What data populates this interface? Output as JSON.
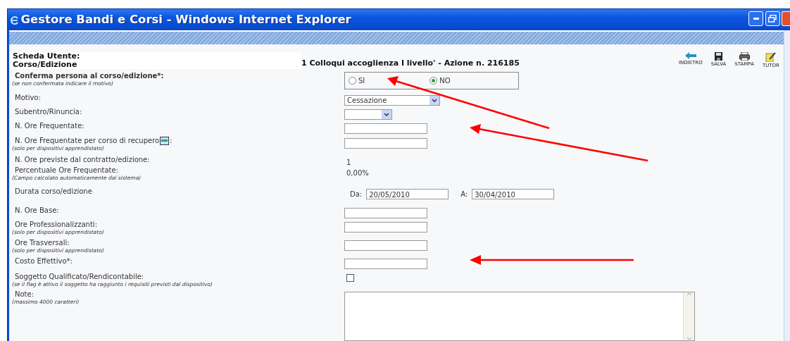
{
  "window": {
    "title": "Gestore Bandi e Corsi - Windows Internet Explorer"
  },
  "header": {
    "label_lines": [
      "Scheda Utente:",
      "Corso/Edizione"
    ],
    "course": "1 Colloqui accoglienza I livello' - Azione n. 216185"
  },
  "toolbar": [
    {
      "label": "INDIETRO",
      "kind": "back"
    },
    {
      "label": "SALVA",
      "kind": "save"
    },
    {
      "label": "STAMPA",
      "kind": "print"
    },
    {
      "label": "TUTOR",
      "kind": "tutor"
    }
  ],
  "fields": [
    {
      "kind": "radio",
      "label": "Conferma persona al corso/edizione*:",
      "note": "(se non confermata indicare il motivo)",
      "options": [
        {
          "label": "SI",
          "selected": false
        },
        {
          "label": "NO",
          "selected": true
        }
      ]
    },
    {
      "kind": "select",
      "label": "Motivo:",
      "value": "Cessazione"
    },
    {
      "kind": "select",
      "label": "Subentro/Rinuncia:"
    },
    {
      "kind": "text",
      "label": "N. Ore Frequentate:"
    },
    {
      "kind": "text",
      "label": "N. Ore Frequentate per corso di recupero",
      "label_end": ":",
      "note": "(solo per dispositivi apprendistato)"
    },
    {
      "kind": "value",
      "label": "N. Ore previste dal contratto/edizione:",
      "value": "1"
    },
    {
      "kind": "value",
      "label": "Percentuale Ore Frequentate:",
      "note": "(Campo calcolato automaticamente dal sistema)",
      "value": "0,00%"
    },
    {
      "kind": "daterange",
      "label": "Durata corso/edizione",
      "from_label": "Da:",
      "from": "20/05/2010",
      "to_label": "A:",
      "to": "30/04/2010"
    },
    {
      "kind": "text",
      "label": "N. Ore Base:"
    },
    {
      "kind": "text",
      "label": "Ore Professionalizzanti:",
      "note": "(solo per dispositivi apprendistato)"
    },
    {
      "kind": "text",
      "label": "Ore Trasversali:",
      "note": "(solo per dispositivi apprendistato)"
    },
    {
      "kind": "text",
      "label": "Costo Effettivo*:"
    },
    {
      "kind": "checkbox",
      "label": "Soggetto Qualificato/Rendicontabile:",
      "note": "(se il flag è attivo il soggetto ha raggiunto i requisiti previsti dal dispositivo)",
      "checked": false
    },
    {
      "kind": "textarea",
      "label": "Note:",
      "note": "(massimo 4000 caratteri)"
    }
  ]
}
